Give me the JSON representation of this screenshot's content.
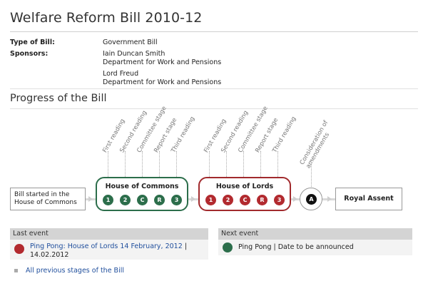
{
  "page": {
    "title": "Welfare Reform Bill 2010-12"
  },
  "details": {
    "type_label": "Type of Bill:",
    "type_value": "Government Bill",
    "sponsors_label": "Sponsors:",
    "sponsors": [
      {
        "name": "Iain Duncan Smith",
        "department": "Department for Work and Pensions"
      },
      {
        "name": "Lord Freud",
        "department": "Department for Work and Pensions"
      }
    ]
  },
  "progress": {
    "title": "Progress of the Bill",
    "stage_labels": [
      "First reading",
      "Second reading",
      "Committee stage",
      "Report stage",
      "Third reading",
      "First reading",
      "Second reading",
      "Committee stage",
      "Report stage",
      "Third reading",
      "Consideration of amendments"
    ],
    "start_text_line1": "Bill started in the",
    "start_text_line2": "House of Commons",
    "commons": {
      "title": "House of Commons",
      "stages": [
        "1",
        "2",
        "C",
        "R",
        "3"
      ],
      "color": "#2c6e4b"
    },
    "lords": {
      "title": "House of Lords",
      "stages": [
        "1",
        "2",
        "C",
        "R",
        "3"
      ],
      "color": "#b22a2f"
    },
    "amendments_marker": "A",
    "royal_assent": "Royal Assent"
  },
  "events": {
    "last_header": "Last event",
    "last_link": "Ping Pong: House of Lords 14 February, 2012",
    "last_sep": "|",
    "last_date": "14.02.2012",
    "last_color": "#b22a2f",
    "next_header": "Next event",
    "next_text": "Ping Pong | Date to be announced",
    "next_color": "#2c6e4b"
  },
  "footer": {
    "previous_stages_link": "All previous stages of the Bill"
  }
}
